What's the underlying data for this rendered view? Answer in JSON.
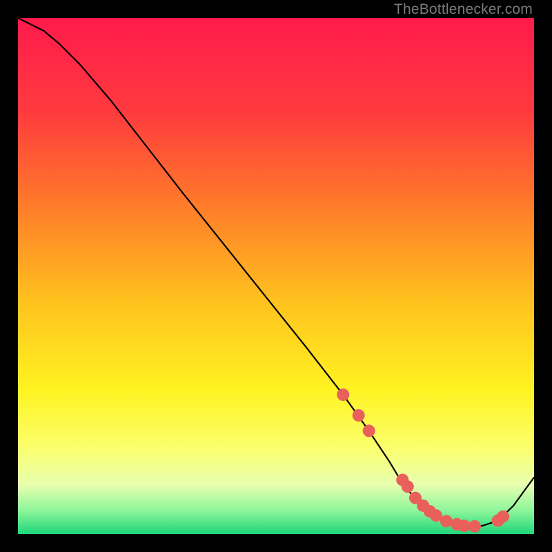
{
  "watermark": "TheBottlenecker.com",
  "gradient": {
    "stops": [
      {
        "offset": 0.0,
        "color": "#ff1a4b"
      },
      {
        "offset": 0.18,
        "color": "#ff3a3f"
      },
      {
        "offset": 0.36,
        "color": "#ff7a2a"
      },
      {
        "offset": 0.55,
        "color": "#ffc21e"
      },
      {
        "offset": 0.72,
        "color": "#fff321"
      },
      {
        "offset": 0.83,
        "color": "#fbff6a"
      },
      {
        "offset": 0.905,
        "color": "#e7ffb0"
      },
      {
        "offset": 0.955,
        "color": "#8cf59a"
      },
      {
        "offset": 1.0,
        "color": "#1fd67a"
      }
    ]
  },
  "chart_data": {
    "type": "line",
    "title": "",
    "xlabel": "",
    "ylabel": "",
    "xlim": [
      0,
      100
    ],
    "ylim": [
      0,
      100
    ],
    "series": [
      {
        "name": "curve",
        "x": [
          0,
          2,
          5,
          8,
          12,
          18,
          25,
          32,
          40,
          48,
          56,
          63,
          68,
          72,
          75,
          78,
          81,
          84,
          87,
          90,
          93,
          96,
          100
        ],
        "y": [
          100,
          99,
          97.5,
          95,
          91,
          84,
          75,
          66,
          56,
          46,
          36,
          27,
          20,
          14,
          9,
          6,
          3.5,
          2.2,
          1.6,
          1.6,
          2.6,
          5.5,
          11
        ]
      }
    ],
    "markers": [
      {
        "x": 63.0,
        "y": 27.0
      },
      {
        "x": 66.0,
        "y": 23.0
      },
      {
        "x": 68.0,
        "y": 20.0
      },
      {
        "x": 74.5,
        "y": 10.5
      },
      {
        "x": 75.5,
        "y": 9.2
      },
      {
        "x": 77.0,
        "y": 7.0
      },
      {
        "x": 78.5,
        "y": 5.5
      },
      {
        "x": 79.8,
        "y": 4.4
      },
      {
        "x": 81.0,
        "y": 3.6
      },
      {
        "x": 83.0,
        "y": 2.5
      },
      {
        "x": 85.0,
        "y": 1.9
      },
      {
        "x": 86.5,
        "y": 1.6
      },
      {
        "x": 88.5,
        "y": 1.5
      },
      {
        "x": 93.0,
        "y": 2.6
      },
      {
        "x": 94.0,
        "y": 3.4
      }
    ],
    "marker_color": "#e9605b",
    "marker_radius": 9,
    "line_color": "#000000",
    "line_width": 2.2
  }
}
